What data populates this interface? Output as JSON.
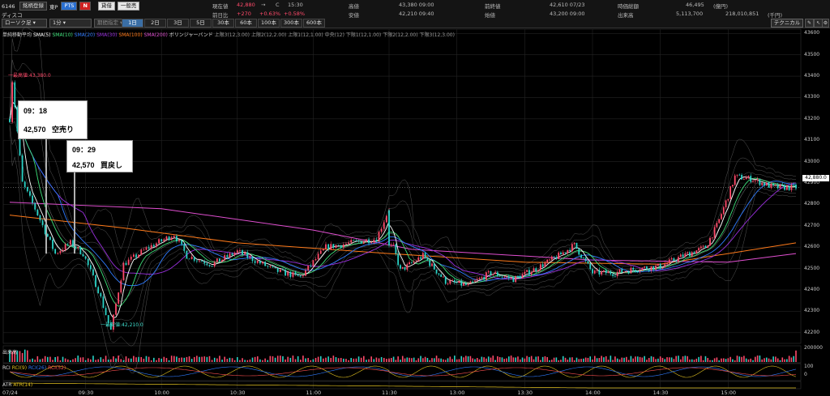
{
  "header": {
    "code": "6146",
    "name": "ディスコ",
    "watch_button": "銘柄登録",
    "market": "東P",
    "pts": "PTS",
    "n_badge": "N",
    "buy_btn": "貸借",
    "sell_btn": "一般売",
    "chart_type": "ローソク足",
    "interval": "1分",
    "period": "期間指定"
  },
  "quotes": {
    "current_label": "現在値",
    "current_value": "42,880",
    "current_arrow": "→",
    "current_flag": "C",
    "current_time": "15:30",
    "change_label": "前日比",
    "change_value": "+270",
    "change_pct1": "+0.63%",
    "change_pct2": "+0.58%",
    "high_label": "高値",
    "high_value": "43,380 09:00",
    "low_label": "安値",
    "low_value": "42,210 09:40",
    "prev_close_label": "前終値",
    "prev_close_value": "42,610 07/23",
    "open_label": "始値",
    "open_value": "43,200 09:00",
    "mktcap_label": "時価総額",
    "mktcap_value": "46,495",
    "mktcap_unit": "(億円)",
    "volume_label": "出来高",
    "volume_value": "5,113,700",
    "turnover_value": "218,010,851",
    "turnover_unit": "(千円)"
  },
  "range_tabs": [
    "1日",
    "2日",
    "3日",
    "5日",
    "30本",
    "60本",
    "100本",
    "300本",
    "600本"
  ],
  "active_tab": "1日",
  "technical_button": "テクニカル",
  "legend": {
    "title": "単純移動平均",
    "items": [
      {
        "label": "SMA(5)",
        "color": "#ffffff"
      },
      {
        "label": "SMA(10)",
        "color": "#3ee07a"
      },
      {
        "label": "SMA(20)",
        "color": "#2f7bff"
      },
      {
        "label": "SMA(30)",
        "color": "#9b30e0"
      },
      {
        "label": "SMA(100)",
        "color": "#ff7a1a"
      },
      {
        "label": "SMA(200)",
        "color": "#e04fd0"
      }
    ],
    "bb_title": "ボリンジャーバンド",
    "bb_items": [
      "上限3(12,3.00)",
      "上限2(12,2.00)",
      "上限1(12,1.00)",
      "中央(12)",
      "下限1(12,1.00)",
      "下限2(12,2.00)",
      "下限3(12,3.00)"
    ]
  },
  "annotations": {
    "high_marker": "一最高値:43,380.0",
    "low_marker": "一最安値:42,210.0"
  },
  "callouts": [
    {
      "time": "09：18",
      "price": "42,570",
      "action": "空売り"
    },
    {
      "time": "09：29",
      "price": "42,570",
      "action": "買戻し"
    }
  ],
  "current_price_tag": "42,880.0",
  "panels": {
    "volume_label": "出来高",
    "volume_max": "200000",
    "rci_label": "RCI",
    "rci_items": [
      "RCI(9)",
      "RCI(26)",
      "RCI(52)"
    ],
    "rci_colors": [
      "#e0c020",
      "#2f7bff",
      "#ff5050"
    ],
    "rci_ticks": [
      "100",
      "0"
    ],
    "atr_label": "ATR",
    "atr_item": "ATR(14)",
    "atr_color": "#e0c020"
  },
  "x_axis": {
    "date": "07/24",
    "times": [
      "09:30",
      "10:00",
      "10:30",
      "11:00",
      "11:30",
      "13:00",
      "13:30",
      "14:00",
      "14:30",
      "15:00"
    ]
  },
  "chart_data": {
    "type": "candlestick",
    "symbol": "6146 ディスコ",
    "interval": "1分",
    "ylim": [
      42150,
      43620
    ],
    "y_ticks": [
      43600,
      43500,
      43400,
      43300,
      43200,
      43100,
      43000,
      42900,
      42800,
      42700,
      42600,
      42500,
      42400,
      42300,
      42200
    ],
    "high": 43380,
    "low": 42210,
    "last": 42880,
    "price_path": [
      {
        "t": "09:00",
        "price": 43200
      },
      {
        "t": "09:01",
        "price": 43380
      },
      {
        "t": "09:05",
        "price": 42900
      },
      {
        "t": "09:10",
        "price": 42780
      },
      {
        "t": "09:18",
        "price": 42570
      },
      {
        "t": "09:24",
        "price": 42620
      },
      {
        "t": "09:29",
        "price": 42570
      },
      {
        "t": "09:35",
        "price": 42400
      },
      {
        "t": "09:40",
        "price": 42210
      },
      {
        "t": "09:45",
        "price": 42520
      },
      {
        "t": "09:55",
        "price": 42600
      },
      {
        "t": "10:05",
        "price": 42660
      },
      {
        "t": "10:10",
        "price": 42560
      },
      {
        "t": "10:20",
        "price": 42520
      },
      {
        "t": "10:30",
        "price": 42580
      },
      {
        "t": "10:45",
        "price": 42490
      },
      {
        "t": "10:55",
        "price": 42460
      },
      {
        "t": "11:05",
        "price": 42600
      },
      {
        "t": "11:15",
        "price": 42620
      },
      {
        "t": "11:25",
        "price": 42640
      },
      {
        "t": "11:30",
        "price": 42780
      },
      {
        "t": "11:32",
        "price": 42840
      },
      {
        "t": "11:35",
        "price": 42720
      },
      {
        "t": "12:32",
        "price": 42600
      },
      {
        "t": "12:35",
        "price": 42490
      },
      {
        "t": "12:45",
        "price": 42560
      },
      {
        "t": "12:55",
        "price": 42440
      },
      {
        "t": "13:05",
        "price": 42420
      },
      {
        "t": "13:15",
        "price": 42480
      },
      {
        "t": "13:25",
        "price": 42450
      },
      {
        "t": "13:35",
        "price": 42500
      },
      {
        "t": "13:45",
        "price": 42560
      },
      {
        "t": "13:52",
        "price": 42610
      },
      {
        "t": "14:00",
        "price": 42480
      },
      {
        "t": "14:10",
        "price": 42480
      },
      {
        "t": "14:20",
        "price": 42500
      },
      {
        "t": "14:30",
        "price": 42510
      },
      {
        "t": "14:40",
        "price": 42560
      },
      {
        "t": "14:50",
        "price": 42600
      },
      {
        "t": "14:55",
        "price": 42700
      },
      {
        "t": "15:00",
        "price": 42840
      },
      {
        "t": "15:03",
        "price": 42930
      },
      {
        "t": "15:10",
        "price": 42920
      },
      {
        "t": "15:20",
        "price": 42880
      },
      {
        "t": "15:30",
        "price": 42880
      }
    ],
    "series": [
      {
        "name": "SMA(100)",
        "values": [
          {
            "t": "09:00",
            "v": 42750
          },
          {
            "t": "09:45",
            "v": 42690
          },
          {
            "t": "10:30",
            "v": 42620
          },
          {
            "t": "11:30",
            "v": 42570
          },
          {
            "t": "13:30",
            "v": 42530
          },
          {
            "t": "14:30",
            "v": 42520
          },
          {
            "t": "15:30",
            "v": 42620
          }
        ]
      },
      {
        "name": "SMA(200)",
        "values": [
          {
            "t": "09:00",
            "v": 42810
          },
          {
            "t": "10:00",
            "v": 42780
          },
          {
            "t": "11:00",
            "v": 42680
          },
          {
            "t": "12:40",
            "v": 42590
          },
          {
            "t": "14:00",
            "v": 42540
          },
          {
            "t": "15:00",
            "v": 42530
          },
          {
            "t": "15:30",
            "v": 42570
          }
        ]
      }
    ]
  }
}
